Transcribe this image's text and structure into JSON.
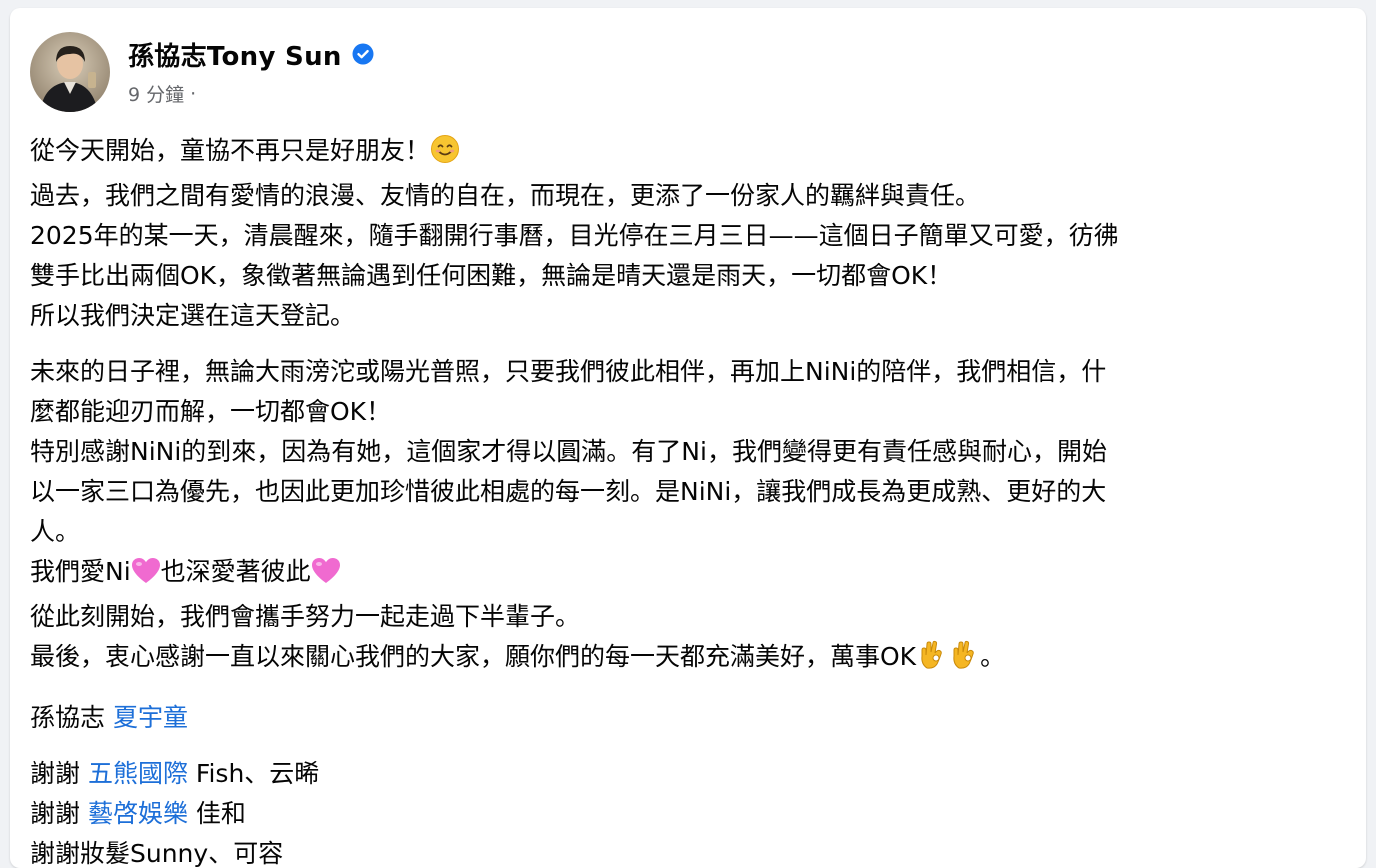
{
  "post": {
    "author": "孫協志Tony Sun",
    "time": "9 分鐘",
    "separator": "·",
    "verified_icon": "verified-badge-icon",
    "colors": {
      "link": "#1d6fd8",
      "verified": "#1877f2",
      "meta": "#65676b",
      "text": "#050505"
    }
  },
  "content": {
    "p1": {
      "l1": "從今天開始，童協不再只是好朋友！",
      "l1_emoji": "smiling-face-icon",
      "l2": "過去，我們之間有愛情的浪漫、友情的自在，而現在，更添了一份家人的羈絆與責任。",
      "l3": "2025年的某一天，清晨醒來，隨手翻開行事曆，目光停在三月三日——這個日子簡單又可愛，彷彿",
      "l4": "雙手比出兩個OK，象徵著無論遇到任何困難，無論是晴天還是雨天，一切都會OK！",
      "l5": "所以我們決定選在這天登記。"
    },
    "p2": {
      "l1": "未來的日子裡，無論大雨滂沱或陽光普照，只要我們彼此相伴，再加上NiNi的陪伴，我們相信，什",
      "l2": "麼都能迎刃而解，一切都會OK！",
      "l3": "特別感謝NiNi的到來，因為有她，這個家才得以圓滿。有了Ni，我們變得更有責任感與耐心，開始",
      "l4": "以一家三口為優先，也因此更加珍惜彼此相處的每一刻。是NiNi，讓我們成長為更成熟、更好的大",
      "l5": "人。",
      "l6a": "我們愛Ni",
      "l6b": "也深愛著彼此",
      "l7": "從此刻開始，我們會攜手努力一起走過下半輩子。",
      "l8a": "最後，衷心感謝一直以來關心我們的大家，願你們的每一天都充滿美好，萬事OK",
      "l8b": "。"
    },
    "signature": {
      "name": "孫協志",
      "tag": "夏宇童"
    },
    "thanks": [
      {
        "prefix": "謝謝 ",
        "tag": "五熊國際",
        "suffix": " Fish、云晞"
      },
      {
        "prefix": "謝謝 ",
        "tag": "藝啓娛樂",
        "suffix": " 佳和"
      },
      {
        "prefix": "謝謝妝髮Sunny、可容",
        "tag": "",
        "suffix": ""
      }
    ]
  }
}
